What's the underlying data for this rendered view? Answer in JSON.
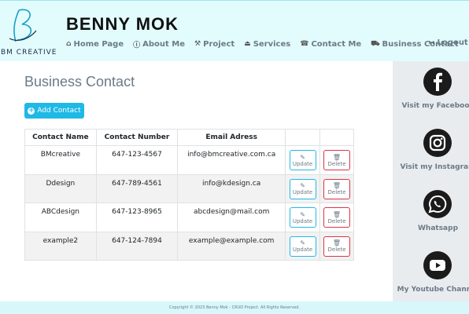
{
  "brand": {
    "logo_text": "BM CREATIVE",
    "title": "BENNY MOK"
  },
  "nav": {
    "items": [
      {
        "label": "Home Page",
        "icon": "home-icon"
      },
      {
        "label": "About Me",
        "icon": "info-icon"
      },
      {
        "label": "Project",
        "icon": "tools-icon"
      },
      {
        "label": "Services",
        "icon": "eject-icon"
      },
      {
        "label": "Contact Me",
        "icon": "phone-icon"
      },
      {
        "label": "Business Contact",
        "icon": "car-icon"
      }
    ],
    "logout": "Logout"
  },
  "main": {
    "title": "Business Contact",
    "add_button": "Add Contact",
    "table": {
      "headers": [
        "Contact Name",
        "Contact Number",
        "Email Adress"
      ],
      "rows": [
        {
          "name": "BMcreative",
          "number": "647-123-4567",
          "email": "info@bmcreative.com.ca"
        },
        {
          "name": "Ddesign",
          "number": "647-789-4561",
          "email": "info@kdesign.ca"
        },
        {
          "name": "ABCdesign",
          "number": "647-123-8965",
          "email": "abcdesign@mail.com"
        },
        {
          "name": "example2",
          "number": "647-124-7894",
          "email": "example@example.com"
        }
      ],
      "update_label": "Update",
      "delete_label": "Delete"
    }
  },
  "sidebar": {
    "items": [
      {
        "label": "Visit my Facebook",
        "icon": "facebook-icon"
      },
      {
        "label": "Visit my Instagram",
        "icon": "instagram-icon"
      },
      {
        "label": "Whatsapp",
        "icon": "whatsapp-icon"
      },
      {
        "label": "My Youtube Channel",
        "icon": "youtube-icon"
      }
    ]
  },
  "footer": {
    "text": "Copyright © 2023 Benny Mok - CRUD Project. All Rights Reserved."
  }
}
